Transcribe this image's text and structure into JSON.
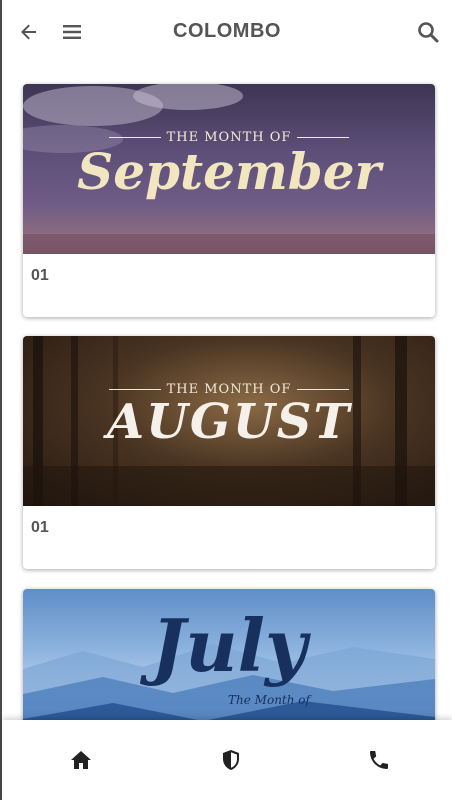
{
  "header": {
    "title": "COLOMBO",
    "icons": {
      "back": "arrow-left-icon",
      "menu": "hamburger-menu-icon",
      "search": "search-icon"
    }
  },
  "cards": [
    {
      "pre_title": "THE MONTH OF",
      "month": "September",
      "caption": "01"
    },
    {
      "pre_title": "THE MONTH OF",
      "month": "AUGUST",
      "caption": "01"
    },
    {
      "pre_title": "The Month of",
      "month": "July",
      "caption": ""
    }
  ],
  "bottom_nav": {
    "items": [
      {
        "icon": "home-icon"
      },
      {
        "icon": "shield-icon"
      },
      {
        "icon": "phone-icon"
      }
    ]
  },
  "colors": {
    "text_gray": "#555555",
    "icon_dark": "#222222",
    "icon_gray": "#555555"
  }
}
